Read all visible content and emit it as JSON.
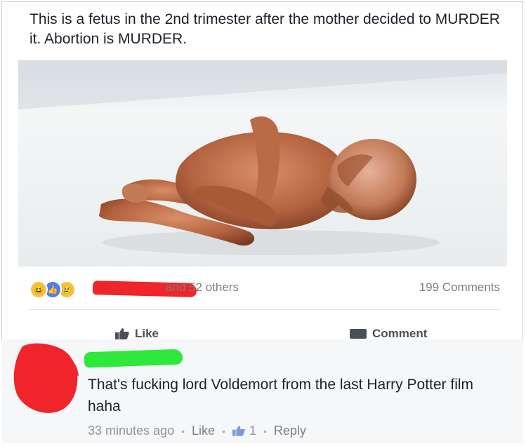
{
  "post": {
    "text": "This is a fetus in the 2nd trimester after the mother decided to MURDER it. Abortion is MURDER."
  },
  "reactions": {
    "others_text": "and 52 others",
    "comments_count": "199 Comments",
    "icons": [
      "haha-icon",
      "like-icon",
      "sad-icon"
    ]
  },
  "actions": {
    "like_label": "Like",
    "comment_label": "Comment"
  },
  "comment": {
    "text": "That's fucking lord Voldemort from the last Harry Potter film haha",
    "time": "33 minutes ago",
    "like_label": "Like",
    "like_count": "1",
    "reply_label": "Reply"
  },
  "colors": {
    "redaction_red": "#f0242b",
    "redaction_green": "#2ee83c",
    "like_blue": "#4e7cf3"
  }
}
